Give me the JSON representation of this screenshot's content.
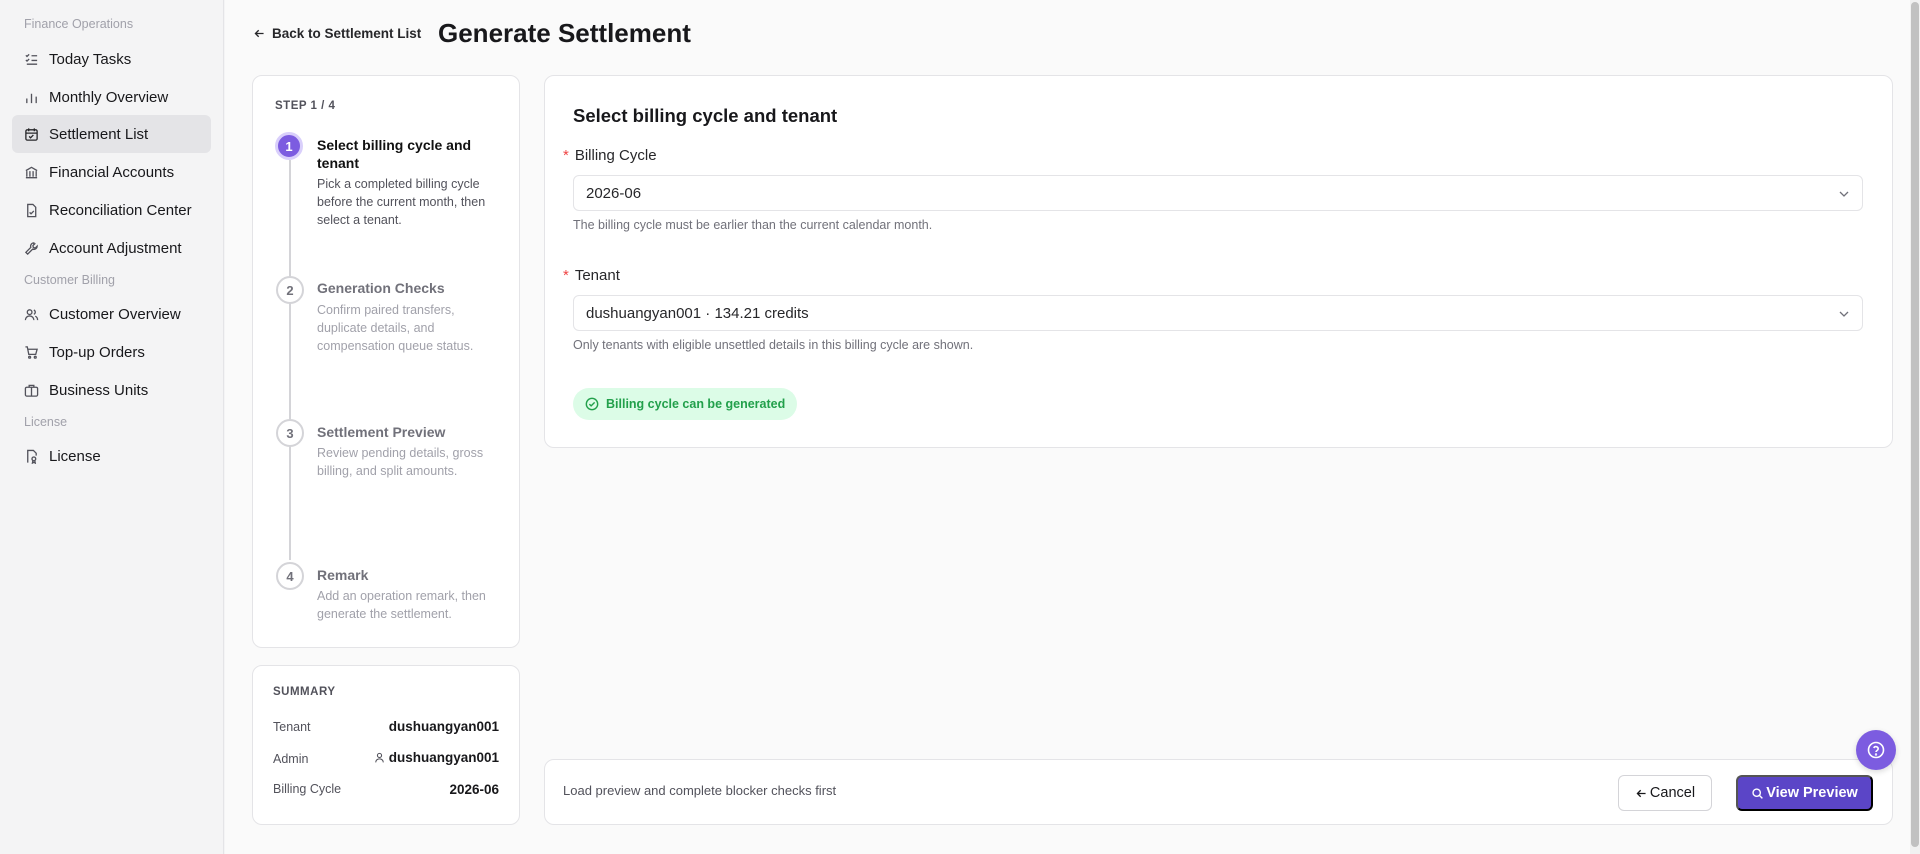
{
  "sidebar": {
    "groups": {
      "finance": "Finance Operations",
      "customer": "Customer Billing",
      "license": "License"
    },
    "items": [
      {
        "label": "Today Tasks",
        "icon": "list-check-icon"
      },
      {
        "label": "Monthly Overview",
        "icon": "bar-chart-icon"
      },
      {
        "label": "Settlement List",
        "icon": "calendar-check-icon",
        "active": true
      },
      {
        "label": "Financial Accounts",
        "icon": "bank-icon"
      },
      {
        "label": "Reconciliation Center",
        "icon": "file-check-icon"
      },
      {
        "label": "Account Adjustment",
        "icon": "wrench-icon"
      },
      {
        "label": "Customer Overview",
        "icon": "users-icon"
      },
      {
        "label": "Top-up Orders",
        "icon": "cart-icon"
      },
      {
        "label": "Business Units",
        "icon": "briefcase-icon"
      },
      {
        "label": "License",
        "icon": "license-icon"
      }
    ]
  },
  "header": {
    "back_label": "Back to Settlement List",
    "title": "Generate Settlement"
  },
  "steps": {
    "counter": "STEP 1 / 4",
    "items": [
      {
        "number": "1",
        "title": "Select billing cycle and tenant",
        "desc": "Pick a completed billing cycle before the current month, then select a tenant.",
        "active": true
      },
      {
        "number": "2",
        "title": "Generation Checks",
        "desc": "Confirm paired transfers, duplicate details, and compensation queue status."
      },
      {
        "number": "3",
        "title": "Settlement Preview",
        "desc": "Review pending details, gross billing, and split amounts."
      },
      {
        "number": "4",
        "title": "Remark",
        "desc": "Add an operation remark, then generate the settlement."
      }
    ]
  },
  "summary": {
    "title": "SUMMARY",
    "tenant_label": "Tenant",
    "tenant_value": "dushuangyan001",
    "admin_label": "Admin",
    "admin_value": "dushuangyan001",
    "cycle_label": "Billing Cycle",
    "cycle_value": "2026-06"
  },
  "form": {
    "title": "Select billing cycle and tenant",
    "required_mark": "*",
    "billing_cycle_label": "Billing Cycle",
    "billing_cycle_value": "2026-06",
    "billing_cycle_hint": "The billing cycle must be earlier than the current calendar month.",
    "tenant_label": "Tenant",
    "tenant_value": "dushuangyan001 · 134.21 credits",
    "tenant_hint": "Only tenants with eligible unsettled details in this billing cycle are shown.",
    "status": "Billing cycle can be generated"
  },
  "footer": {
    "message": "Load preview and complete blocker checks first",
    "cancel_label": "Cancel",
    "preview_label": "View Preview"
  },
  "colors": {
    "accent": "#7c5ce0",
    "primary_button": "#5b45c7",
    "success": "#22a04b",
    "required": "#ef4444"
  }
}
